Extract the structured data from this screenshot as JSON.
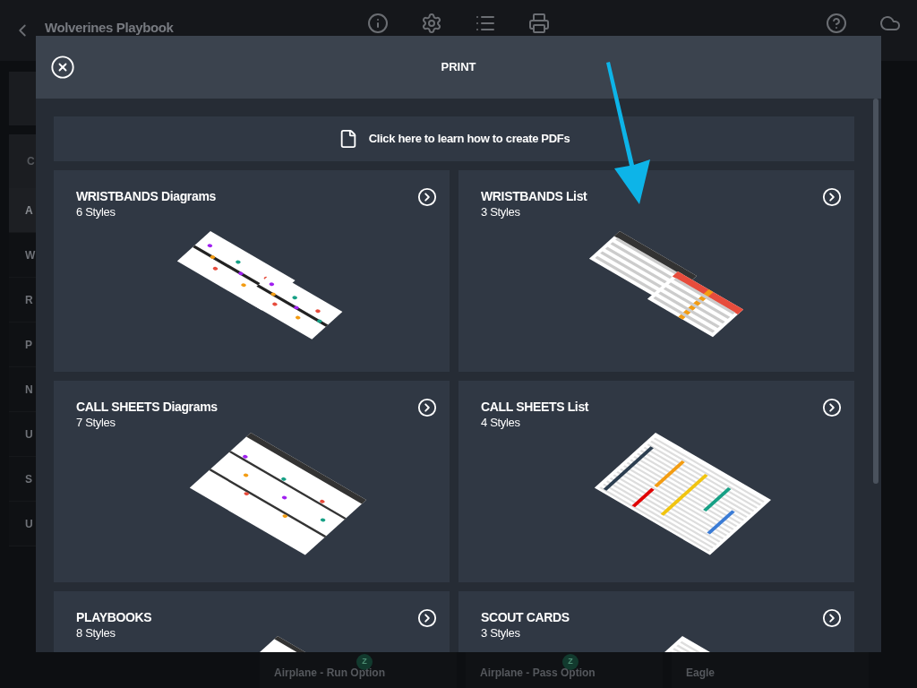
{
  "app_bar": {
    "title": "Wolverines Playbook"
  },
  "sidebar": {
    "header": "C",
    "items": [
      {
        "label": "A",
        "selected": true
      },
      {
        "label": "W",
        "selected": false
      },
      {
        "label": "R",
        "selected": false
      },
      {
        "label": "P",
        "selected": false
      },
      {
        "label": "N",
        "selected": false
      },
      {
        "label": "U",
        "selected": false
      },
      {
        "label": "S",
        "selected": false
      },
      {
        "label": "U",
        "selected": false
      }
    ]
  },
  "play_cards": [
    {
      "name": "Airplane - Run Option",
      "badge": "Z"
    },
    {
      "name": "Airplane - Pass Option",
      "badge": "Z"
    },
    {
      "name": "Eagle"
    }
  ],
  "print_dialog": {
    "title": "PRINT",
    "info_link": "Click here to learn how to create PDFs",
    "options": [
      {
        "title": "WRISTBANDS Diagrams",
        "styles": "6 Styles",
        "kind": "wristband-diagrams"
      },
      {
        "title": "WRISTBANDS List",
        "styles": "3 Styles",
        "kind": "wristband-list"
      },
      {
        "title": "CALL SHEETS Diagrams",
        "styles": "7 Styles",
        "kind": "callsheet-diagrams"
      },
      {
        "title": "CALL SHEETS List",
        "styles": "4 Styles",
        "kind": "callsheet-list"
      },
      {
        "title": "PLAYBOOKS",
        "styles": "8 Styles",
        "kind": "playbook"
      },
      {
        "title": "SCOUT CARDS",
        "styles": "3 Styles",
        "kind": "scout"
      }
    ]
  }
}
